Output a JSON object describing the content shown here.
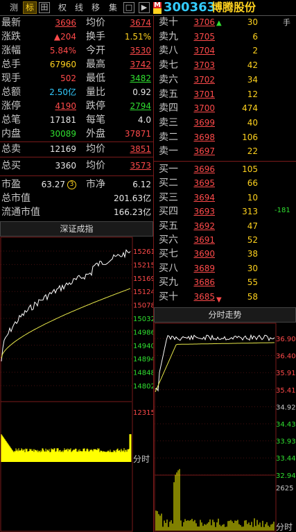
{
  "toolbar": {
    "items": [
      "测",
      "标",
      "田",
      "权",
      "线",
      "移",
      "集",
      "□",
      "▶"
    ],
    "selected_index": 1
  },
  "stock": {
    "code": "300363",
    "name": "博腾股份",
    "market_badge": "M"
  },
  "quote": {
    "latest_label": "最新",
    "latest": "3696",
    "avg_label": "均价",
    "avg": "3674",
    "change_label": "涨跌",
    "change": "▲204",
    "turnover_label": "换手",
    "turnover": "1.51%",
    "pct_label": "涨幅",
    "pct": "5.84%",
    "open_label": "今开",
    "open": "3530",
    "total_vol_label": "总手",
    "total_vol": "67960",
    "high_label": "最高",
    "high": "3742",
    "cur_vol_label": "现手",
    "cur_vol": "502",
    "low_label": "最低",
    "low": "3482",
    "amount_label": "总额",
    "amount": "2.50亿",
    "ratio_label": "量比",
    "ratio": "0.92",
    "limit_up_label": "涨停",
    "limit_up": "4190",
    "limit_down_label": "跌停",
    "limit_down": "2794",
    "trades_label": "总笔",
    "trades": "17181",
    "per_trade_label": "每笔",
    "per_trade": "4.0",
    "inner_label": "内盘",
    "inner": "30089",
    "outer_label": "外盘",
    "outer": "37871",
    "total_sell_label": "总卖",
    "total_sell": "12169",
    "sell_avg_label": "均价",
    "sell_avg": "3851",
    "total_buy_label": "总买",
    "total_buy": "3360",
    "buy_avg_label": "均价",
    "buy_avg": "3573",
    "pe_label": "市盈",
    "pe": "63.27",
    "pe_badge": "3",
    "pb_label": "市净",
    "pb": "6.12",
    "mcap_label": "总市值",
    "mcap": "201.63亿",
    "float_label": "流通市值",
    "float": "166.23亿"
  },
  "sells": [
    {
      "label": "卖十",
      "price": "3706",
      "vol": "30"
    },
    {
      "label": "卖九",
      "price": "3705",
      "vol": "6"
    },
    {
      "label": "卖八",
      "price": "3704",
      "vol": "2"
    },
    {
      "label": "卖七",
      "price": "3703",
      "vol": "42"
    },
    {
      "label": "卖六",
      "price": "3702",
      "vol": "34"
    },
    {
      "label": "卖五",
      "price": "3701",
      "vol": "12"
    },
    {
      "label": "卖四",
      "price": "3700",
      "vol": "474"
    },
    {
      "label": "卖三",
      "price": "3699",
      "vol": "40"
    },
    {
      "label": "卖二",
      "price": "3698",
      "vol": "106"
    },
    {
      "label": "卖一",
      "price": "3697",
      "vol": "22"
    }
  ],
  "buys": [
    {
      "label": "买一",
      "price": "3696",
      "vol": "105"
    },
    {
      "label": "买二",
      "price": "3695",
      "vol": "66"
    },
    {
      "label": "买三",
      "price": "3694",
      "vol": "10"
    },
    {
      "label": "买四",
      "price": "3693",
      "vol": "313"
    },
    {
      "label": "买五",
      "price": "3692",
      "vol": "47"
    },
    {
      "label": "买六",
      "price": "3691",
      "vol": "52"
    },
    {
      "label": "买七",
      "price": "3690",
      "vol": "38"
    },
    {
      "label": "买八",
      "price": "3689",
      "vol": "30"
    },
    {
      "label": "买九",
      "price": "3686",
      "vol": "55"
    },
    {
      "label": "买十",
      "price": "3685",
      "vol": "58"
    }
  ],
  "side_note": {
    "hand_label": "手",
    "delta": "-181"
  },
  "index_chart": {
    "title": "深证成指",
    "y_ticks": [
      "15261",
      "15215",
      "15169",
      "15124",
      "15078",
      "15032",
      "14986",
      "14940",
      "14894",
      "14848",
      "14802"
    ],
    "vol_tick": "12315",
    "footer": "分时"
  },
  "stock_chart": {
    "title": "分时走势",
    "y_ticks": [
      "36.90",
      "36.40",
      "35.91",
      "35.41",
      "34.92",
      "34.43",
      "33.93",
      "33.44",
      "32.94"
    ],
    "vol_tick": "2625",
    "footer": "分时"
  },
  "colors": {
    "price_line": "#ffffff",
    "avg_line": "#e8e84a",
    "volume": "#ffff00",
    "grid": "#7a1a1a",
    "up": "#ff4a4a",
    "down": "#30e030"
  }
}
